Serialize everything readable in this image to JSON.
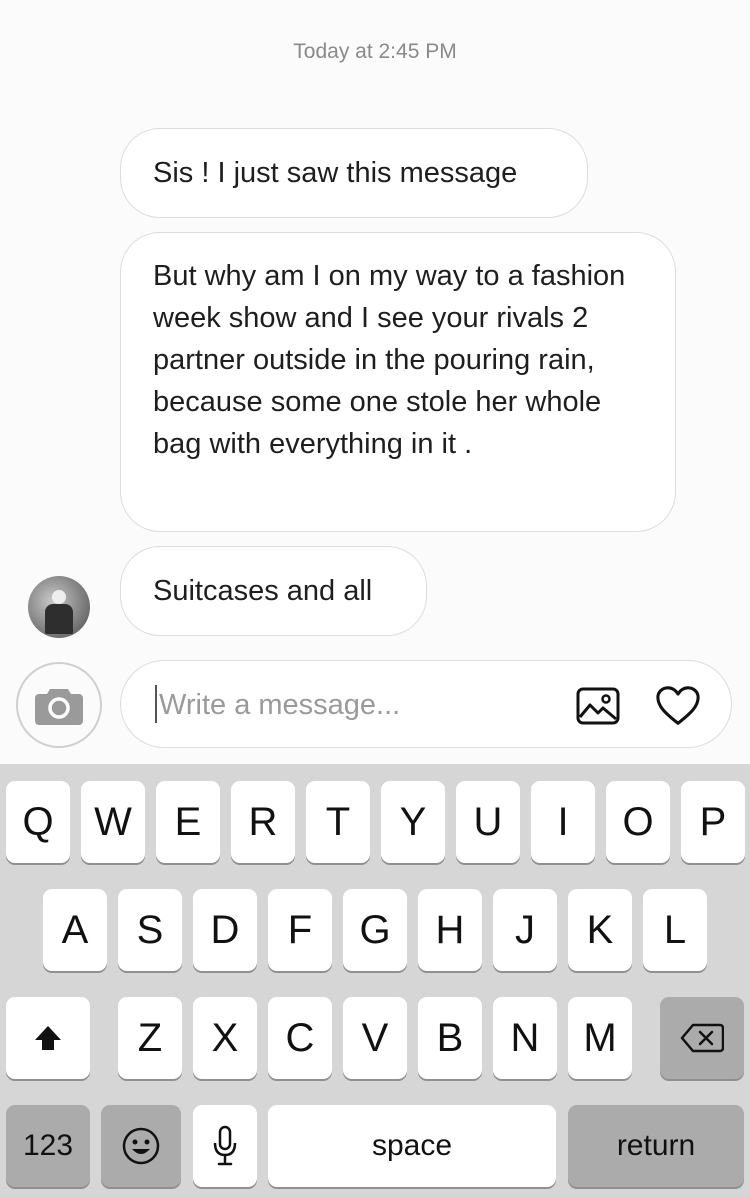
{
  "conversation": {
    "timestamp": "Today at 2:45 PM",
    "messages": [
      "Sis ! I just saw this message",
      "But why am I on my way to a fashion week show and I see your rivals 2 partner outside in the pouring rain, because some one stole her whole bag with everything in it .",
      "Suitcases and all"
    ],
    "sender_avatar": "avatar-photo"
  },
  "composer": {
    "placeholder": "Write a message...",
    "camera_icon": "camera-icon",
    "gallery_icon": "gallery-icon",
    "heart_icon": "heart-icon"
  },
  "keyboard": {
    "row1": [
      "Q",
      "W",
      "E",
      "R",
      "T",
      "Y",
      "U",
      "I",
      "O",
      "P"
    ],
    "row2": [
      "A",
      "S",
      "D",
      "F",
      "G",
      "H",
      "J",
      "K",
      "L"
    ],
    "row3": [
      "Z",
      "X",
      "C",
      "V",
      "B",
      "N",
      "M"
    ],
    "numbers_label": "123",
    "space_label": "space",
    "return_label": "return",
    "shift_icon": "shift-icon",
    "delete_icon": "delete-icon",
    "emoji_icon": "emoji-icon",
    "mic_icon": "microphone-icon"
  }
}
